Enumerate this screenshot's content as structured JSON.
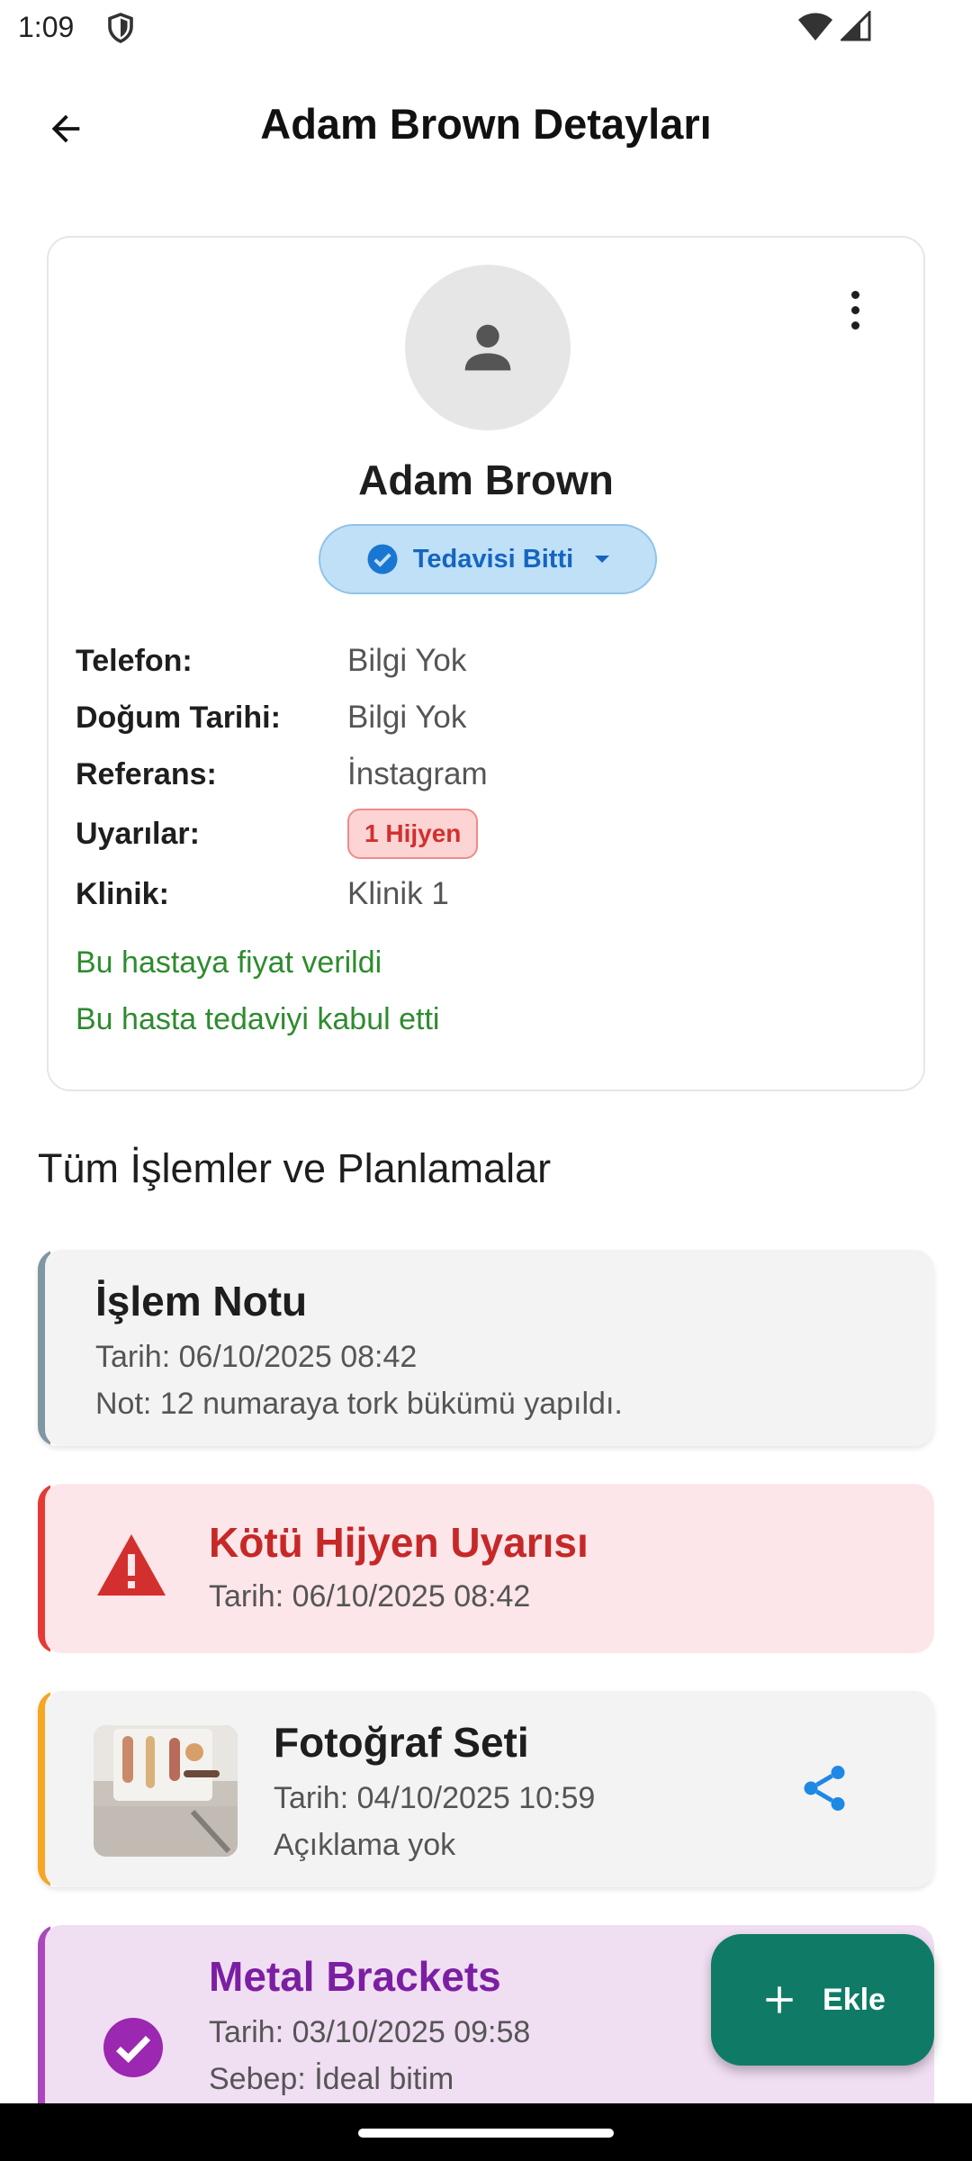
{
  "status_bar": {
    "time": "1:09"
  },
  "header": {
    "title": "Adam Brown Detayları"
  },
  "patient": {
    "name": "Adam Brown",
    "status_label": "Tedavisi Bitti",
    "fields": [
      {
        "label": "Telefon:",
        "value": "Bilgi Yok"
      },
      {
        "label": "Doğum Tarihi:",
        "value": "Bilgi Yok"
      },
      {
        "label": "Referans:",
        "value": "İnstagram"
      },
      {
        "label": "Uyarılar:",
        "value": "1 Hijyen"
      },
      {
        "label": "Klinik:",
        "value": "Klinik 1"
      }
    ],
    "notes": [
      "Bu hastaya fiyat verildi",
      "Bu hasta tedaviyi kabul etti"
    ]
  },
  "section": {
    "title": "Tüm İşlemler ve Planlamalar"
  },
  "entries": {
    "note": {
      "title": "İşlem Notu",
      "date": "Tarih: 06/10/2025 08:42",
      "text": "Not: 12 numaraya tork bükümü yapıldı."
    },
    "hygiene": {
      "title": "Kötü Hijyen Uyarısı",
      "date": "Tarih: 06/10/2025 08:42"
    },
    "photo": {
      "title": "Fotoğraf Seti",
      "date": "Tarih: 04/10/2025 10:59",
      "description": "Açıklama yok"
    },
    "brackets": {
      "title": "Metal Brackets",
      "date": "Tarih: 03/10/2025 09:58",
      "reason": "Sebep: İdeal bitim"
    }
  },
  "fab": {
    "label": "Ekle"
  },
  "colors": {
    "status_chip": "#bfe0f7",
    "note_bar": "#7f96a3",
    "hygiene_bar": "#e53935",
    "photo_bar": "#f5a623",
    "brackets_bar": "#ab47bc",
    "fab": "#0f7b66",
    "green_note": "#2e8b2e"
  },
  "icons": {
    "back": "arrow-left-icon",
    "avatar": "person-icon",
    "more": "more-vert-icon",
    "status": "check-circle-icon",
    "warning": "warning-triangle-icon",
    "share": "share-icon",
    "done": "check-circle-icon",
    "add": "plus-icon"
  }
}
